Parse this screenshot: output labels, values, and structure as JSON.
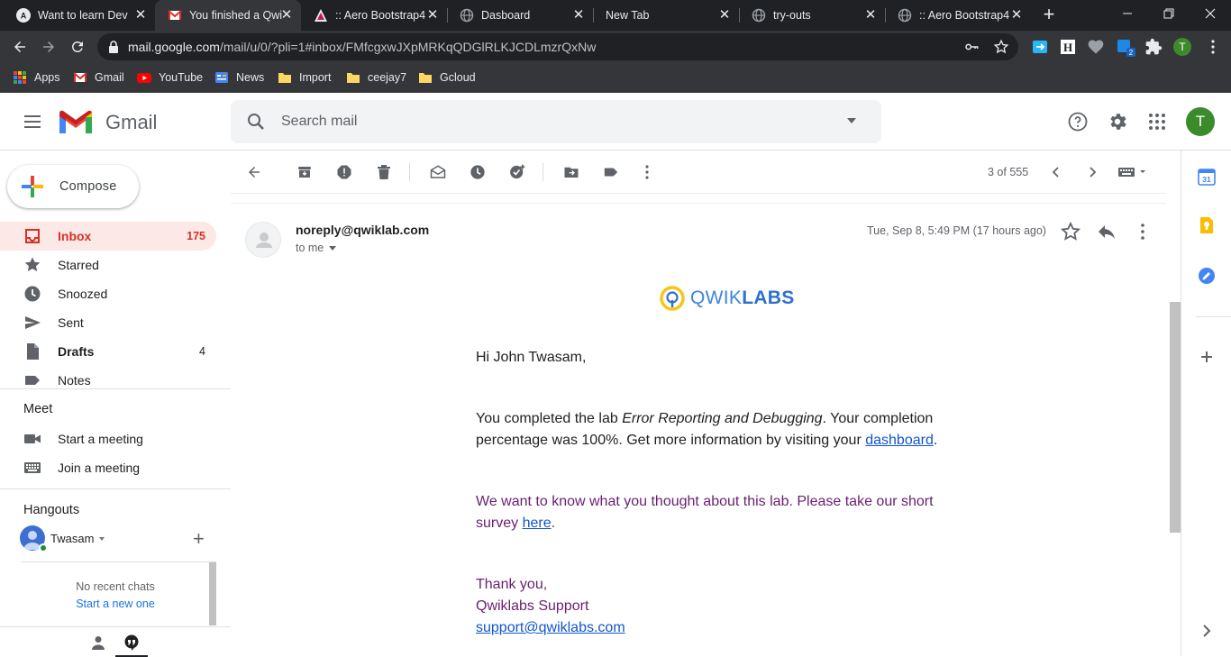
{
  "browser": {
    "tabs": [
      {
        "label": "Want to learn Dev",
        "active": false
      },
      {
        "label": "You finished a Qwi",
        "active": true
      },
      {
        "label": ":: Aero Bootstrap4",
        "active": false
      },
      {
        "label": "Dasboard",
        "active": false
      },
      {
        "label": "New Tab",
        "active": false
      },
      {
        "label": "try-outs",
        "active": false
      },
      {
        "label": ":: Aero Bootstrap4",
        "active": false
      }
    ],
    "close_glyph": "✕",
    "new_tab_glyph": "+",
    "url_host": "mail.google.com",
    "url_path": "/mail/u/0/?pli=1#inbox/FMfcgxwJXpMRKqQDGlRLKJCDLmzrQxNw",
    "profile_initial": "T",
    "bookmarks": [
      {
        "label": "Apps",
        "icon": "apps-grid-icon"
      },
      {
        "label": "Gmail",
        "icon": "gmail-icon"
      },
      {
        "label": "YouTube",
        "icon": "youtube-icon"
      },
      {
        "label": "News",
        "icon": "news-icon"
      },
      {
        "label": "Import",
        "icon": "folder-icon"
      },
      {
        "label": "ceejay7",
        "icon": "folder-icon"
      },
      {
        "label": "Gcloud",
        "icon": "folder-icon"
      }
    ]
  },
  "gmail": {
    "brand": "Gmail",
    "search_placeholder": "Search mail",
    "account_initial": "T",
    "compose_label": "Compose",
    "nav": [
      {
        "label": "Inbox",
        "count": "175",
        "icon": "inbox-icon",
        "active": true,
        "bold": true
      },
      {
        "label": "Starred",
        "count": "",
        "icon": "star-icon",
        "active": false,
        "bold": false
      },
      {
        "label": "Snoozed",
        "count": "",
        "icon": "clock-icon",
        "active": false,
        "bold": false
      },
      {
        "label": "Sent",
        "count": "",
        "icon": "send-icon",
        "active": false,
        "bold": false
      },
      {
        "label": "Drafts",
        "count": "4",
        "icon": "draft-icon",
        "active": false,
        "bold": true
      },
      {
        "label": "Notes",
        "count": "",
        "icon": "label-icon",
        "active": false,
        "bold": false
      }
    ],
    "meet": {
      "title": "Meet",
      "start": "Start a meeting",
      "join": "Join a meeting"
    },
    "hangouts": {
      "title": "Hangouts",
      "user": "Twasam",
      "no_chats": "No recent chats",
      "start_new": "Start a new one"
    },
    "toolbar": {
      "pager": "3 of 555"
    },
    "message": {
      "sender": "noreply@qwiklab.com",
      "to": "to me",
      "date": "Tue, Sep 8, 5:49 PM (17 hours ago)",
      "logo_light": "QWIK",
      "logo_bold": "LABS",
      "greeting": "Hi John Twasam,",
      "p1_a": "You completed the lab ",
      "p1_lab": "Error Reporting and Debugging",
      "p1_b": ". Your completion percentage was 100%. Get more information by visiting your ",
      "p1_link": "dashboard",
      "p1_end": ".",
      "p2_a": "We want to know what you thought about this lab. Please take our short survey ",
      "p2_link": "here",
      "p2_end": ".",
      "sign1": "Thank you,",
      "sign2": "Qwiklabs Support",
      "sign_email": "support@qwiklabs.com"
    },
    "side_panel": {
      "calendar_day": "31"
    }
  },
  "colors": {
    "gmail_red": "#d93025",
    "active_bg": "#fce8e6",
    "link": "#1155cc",
    "purple": "#6b2172",
    "qwik_yellow": "#f5c518",
    "qwik_blue": "#2c6fd1"
  }
}
